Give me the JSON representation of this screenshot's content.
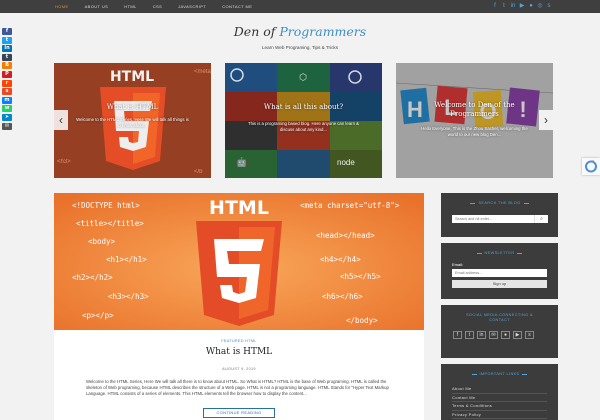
{
  "nav": {
    "items": [
      "Home",
      "About Us",
      "Html",
      "CSS",
      "JavaScript",
      "Contact Me"
    ]
  },
  "top_icons": [
    "facebook-icon",
    "twitter-icon",
    "linkedin-icon",
    "youtube-icon",
    "github-icon",
    "instagram-icon",
    "skype-icon"
  ],
  "share": [
    {
      "icon": "facebook-icon",
      "glyph": "f",
      "color": "#3b5998"
    },
    {
      "icon": "twitter-icon",
      "glyph": "t",
      "color": "#1da1f2"
    },
    {
      "icon": "linkedin-icon",
      "glyph": "in",
      "color": "#0077b5"
    },
    {
      "icon": "tumblr-icon",
      "glyph": "t",
      "color": "#35465c"
    },
    {
      "icon": "blogger-icon",
      "glyph": "B",
      "color": "#f57d00"
    },
    {
      "icon": "pinterest-icon",
      "glyph": "P",
      "color": "#cb2027"
    },
    {
      "icon": "reddit-icon",
      "glyph": "r",
      "color": "#ff4500"
    },
    {
      "icon": "stumbleupon-icon",
      "glyph": "s",
      "color": "#eb4924"
    },
    {
      "icon": "messenger-icon",
      "glyph": "m",
      "color": "#0084ff"
    },
    {
      "icon": "whatsapp-icon",
      "glyph": "w",
      "color": "#25d366"
    },
    {
      "icon": "telegram-icon",
      "glyph": "➤",
      "color": "#0088cc"
    },
    {
      "icon": "email-icon",
      "glyph": "✉",
      "color": "#555555"
    }
  ],
  "header": {
    "title_part1": "Den of ",
    "title_part2": "Programmers",
    "tagline": "Learn Web Programing, Tips & Tricks"
  },
  "slides": [
    {
      "title": "What is HTML",
      "excerpt": "Welcome to the HTML Series, Here We will talk all things is to know about..."
    },
    {
      "title": "What is all this about?",
      "excerpt": "This is a programing based blog. Here anyone can learn & discuss about any kind..."
    },
    {
      "title": "Welcome to Den of the Programmers",
      "excerpt": "Hello Everyone, This is the Zhou Sacher, welcoming the world to our new blog Den..."
    }
  ],
  "featured_art": {
    "top_left": [
      "<!DOCTYPE html>",
      "<title></title>",
      "<body>",
      "<h1></h1>",
      "<h2></h2>",
      "<h3></h3>",
      "<p></p>"
    ],
    "top_right": [
      "<meta charset=\"utf-8\">",
      "<head></head>",
      "<h4></h4>",
      "<h5></h5>",
      "<h6></h6>",
      "</body>"
    ],
    "logo_text": "HTML",
    "logo_num": "5"
  },
  "post": {
    "category": "FEATURED   HTML",
    "title": "What is HTML",
    "date": "AUGUST 9, 2019",
    "body": "Welcome to the HTML Series, Here We will talk all there is to know about HTML. So What is HTML? HTML is the base of Web programing. HTML is called the skeleton of Web programing, because HTML describes the structure of a Web page. HTML is not a programing language. HTML Stands for \"Hyper Text Markup Language. HTML consists of a series of elements. This HTML elements tell the browser how to display the content...",
    "read_more": "CONTINUE READING"
  },
  "sidebar": {
    "search_title": "Search the Blog",
    "search_placeholder": "Search and hit enter...",
    "newsletter_title": "Newsletter",
    "email_label": "Email:",
    "email_placeholder": "Email address...",
    "signup_label": "Sign up",
    "social_title": "Social Media Connecting & Contact",
    "important_title": "Important Links",
    "links": [
      "About Me",
      "Contact Me",
      "Terms & Conditions",
      "Privacy Policy"
    ]
  },
  "colors": {
    "accent": "#3c8fc7",
    "nav_active": "#e38b2a",
    "topbar": "#3f3f3f",
    "widget": "#3c3c3c"
  }
}
